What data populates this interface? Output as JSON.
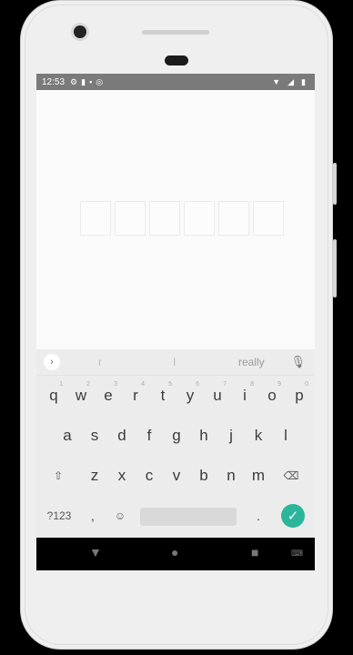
{
  "statusbar": {
    "time": "12:53",
    "icons_left": [
      "gear-icon",
      "sim-icon",
      "storage-icon",
      "sync-icon"
    ],
    "icons_right": [
      "wifi-icon",
      "signal-icon",
      "battery-icon"
    ]
  },
  "otp_boxes": [
    "",
    "",
    "",
    "",
    "",
    ""
  ],
  "keyboard": {
    "suggestions": [
      "r",
      "I",
      "really"
    ],
    "row1": [
      {
        "key": "q",
        "hint": "1"
      },
      {
        "key": "w",
        "hint": "2"
      },
      {
        "key": "e",
        "hint": "3"
      },
      {
        "key": "r",
        "hint": "4"
      },
      {
        "key": "t",
        "hint": "5"
      },
      {
        "key": "y",
        "hint": "6"
      },
      {
        "key": "u",
        "hint": "7"
      },
      {
        "key": "i",
        "hint": "8"
      },
      {
        "key": "o",
        "hint": "9"
      },
      {
        "key": "p",
        "hint": "0"
      }
    ],
    "row2": [
      "a",
      "s",
      "d",
      "f",
      "g",
      "h",
      "j",
      "k",
      "l"
    ],
    "row3": [
      "z",
      "x",
      "c",
      "v",
      "b",
      "n",
      "m"
    ],
    "row4": {
      "symbols_label": "?123",
      "comma": ",",
      "period": "."
    }
  },
  "colors": {
    "enter": "#2bb59a",
    "statusbar": "#7a7a7a"
  }
}
